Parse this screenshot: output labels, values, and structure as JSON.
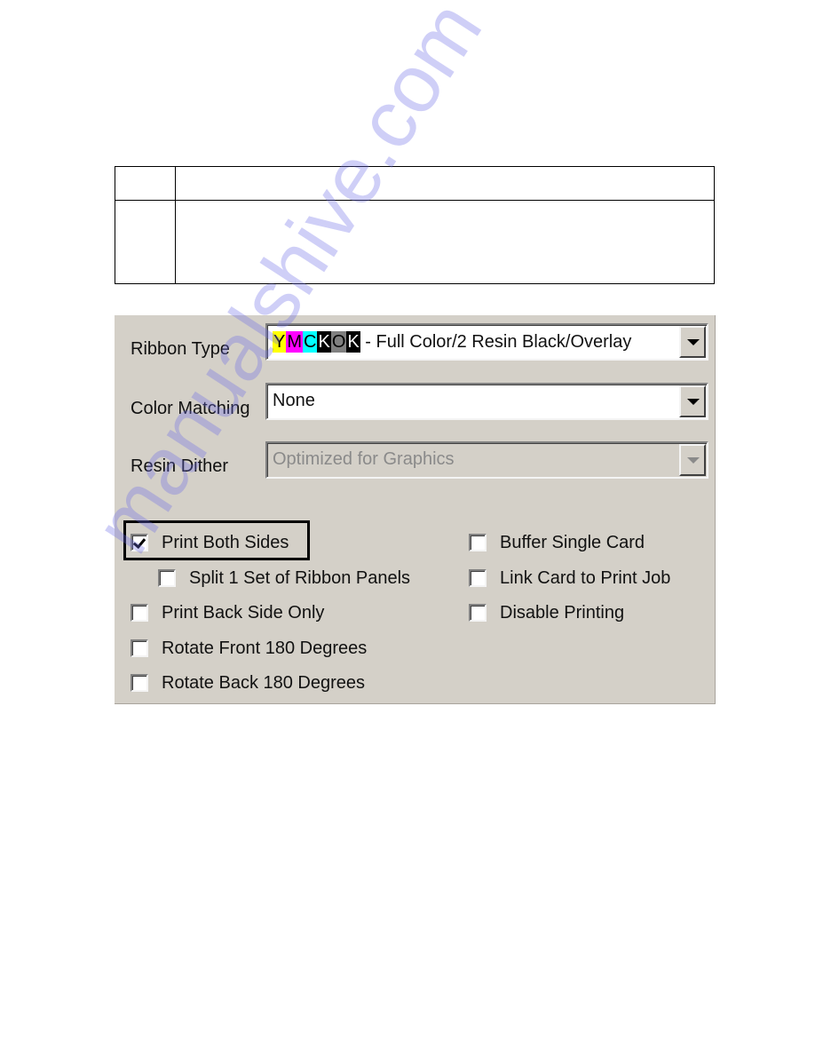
{
  "ribbon_type": {
    "label": "Ribbon Type",
    "panels": [
      {
        "letter": "Y",
        "bg": "#ffff00",
        "fg": "#000000"
      },
      {
        "letter": "M",
        "bg": "#ff00ff",
        "fg": "#000000"
      },
      {
        "letter": "C",
        "bg": "#00ffff",
        "fg": "#000000"
      },
      {
        "letter": "K",
        "bg": "#000000",
        "fg": "#ffffff"
      },
      {
        "letter": "O",
        "bg": "#808080",
        "fg": "#000000"
      },
      {
        "letter": "K",
        "bg": "#000000",
        "fg": "#ffffff"
      }
    ],
    "value_text": " - Full Color/2 Resin Black/Overlay"
  },
  "color_matching": {
    "label": "Color Matching",
    "value": "None"
  },
  "resin_dither": {
    "label": "Resin Dither",
    "value": "Optimized for Graphics",
    "disabled": true
  },
  "options": {
    "print_both_sides": {
      "label": "Print Both Sides",
      "checked": true,
      "highlighted": true
    },
    "split_ribbon_panels": {
      "label": "Split 1 Set of Ribbon Panels",
      "checked": false
    },
    "print_back_side_only": {
      "label": "Print Back Side Only",
      "checked": false
    },
    "rotate_front": {
      "label": "Rotate Front 180 Degrees",
      "checked": false
    },
    "rotate_back": {
      "label": "Rotate Back 180 Degrees",
      "checked": false
    },
    "buffer_single_card": {
      "label": "Buffer Single Card",
      "checked": false
    },
    "link_card_to_print_job": {
      "label": "Link Card to Print Job",
      "checked": false
    },
    "disable_printing": {
      "label": "Disable Printing",
      "checked": false
    }
  },
  "watermark": "manualshive.com"
}
